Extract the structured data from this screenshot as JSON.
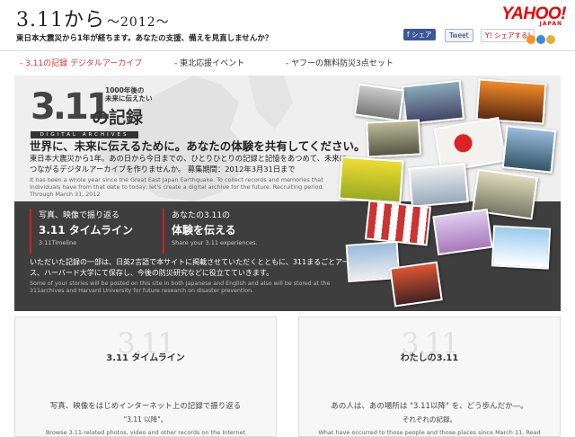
{
  "header": {
    "site_title": "3.11から",
    "site_title_sub": "〜2012〜",
    "tagline": "東日本大震災から1年が経ちます。あなたの支援、備えを見直しませんか？",
    "brand": "YAHOO!",
    "brand_sub": "JAPAN",
    "share_facebook": "f シェア",
    "share_twitter": "Tweet",
    "share_yahoo": "Y! シェアする!"
  },
  "nav": {
    "items": [
      {
        "label": "- 3.11の記録 デジタルアーカイブ"
      },
      {
        "label": "- 東北応援イベント"
      },
      {
        "label": "- ヤフーの無料防災3点セット"
      }
    ]
  },
  "hero": {
    "brand_number": "3.11",
    "brand_kiroku": "の記録",
    "brand_small_1": "1000年後の",
    "brand_small_2": "未来に伝えたい",
    "brand_bar": "DIGITAL ARCHIVES",
    "headline": "世界に、未来に伝えるために。あなたの体験を共有してください。",
    "description": "東日本大震災から1年。あの日から今日までの、ひとりひとりの記録と記憶をあつめて、未来につながるデジタルアーカイブを作りませんか。 募集期間：2012年3月31日まで",
    "description_en": "It has been a whole year since the Great East Japan Earthquake. To collect records and memories that individuals have from that date to today, let's create a digital archive for the future. Recruiting period: Through March 31, 2012",
    "card1": {
      "line1": "写真、映像で振り返る",
      "line2": "3.11 タイムライン",
      "line3": "3.11Timeline"
    },
    "card2": {
      "line1": "あなたの3.11の",
      "line2": "体験を伝える",
      "line3": "Share your 3.11 experiences."
    },
    "notice": "いただいた記録の一部は、日英2言語で本サイトに掲載させていただくとともに、311まるごとアーカイブス、ハーバード大学にて保存し、今後の防災研究などに役立てていきます。",
    "notice_en": "Some of your stories will be posted on this site in both Japanese and English and also will be stored at the 311archives and Harvard University for future research on disaster prevention."
  },
  "boxes": {
    "left": {
      "title": "3.11 タイムライン",
      "deco": "3.11",
      "text1": "写真、映像をはじめインターネット上の記録で振り返る",
      "text2": "\"3.11 以降\"。",
      "text3": "Browse 3.11-related photos, video and other records on the Internet"
    },
    "right": {
      "title": "わたしの3.11",
      "deco": "3.11",
      "text1": "あの人は、あの場所は \"3.11以降\" を、どう歩んだか―。",
      "text2": "それぞれの記録。",
      "text3": "What have occurred to those people and those places since March 11. Read"
    }
  },
  "colors": {
    "accent": "#d33333",
    "dark_band": "#3e3e3e",
    "hero_bg": "#efefef"
  }
}
